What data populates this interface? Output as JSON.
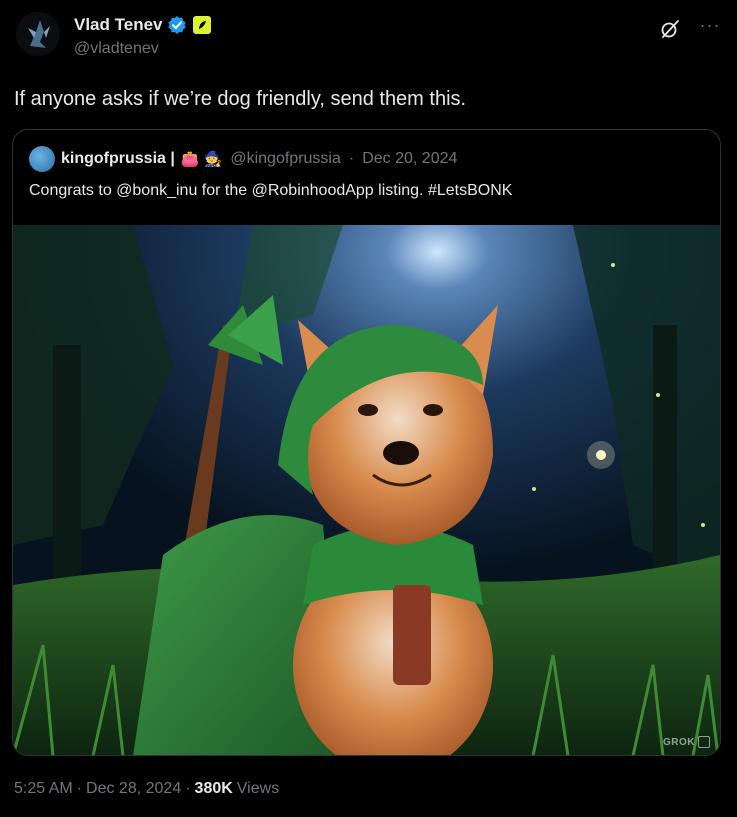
{
  "author": {
    "display_name": "Vlad Tenev",
    "handle": "@vladtenev",
    "verified_icon": "verified-badge-icon",
    "affiliation_icon": "robinhood-feather-icon",
    "accent_color": "#1d9bf0",
    "affiliation_color": "#dcf42e"
  },
  "toolbar": {
    "grok_icon": "grok-icon",
    "more_icon": "more-options-icon",
    "more_glyph": "···"
  },
  "tweet": {
    "text": "If anyone asks if we’re dog friendly, send them this."
  },
  "quote": {
    "display_name": "kingofprussia |",
    "emojis": "👛 🧙",
    "handle": "@kingofprussia",
    "separator": "·",
    "date": "Dec 20, 2024",
    "text": "Congrats to @bonk_inu for the @RobinhoodApp listing. #LetsBONK",
    "image_alt": "shiba-inu-robin-hood-image",
    "watermark": "GROK"
  },
  "footer": {
    "time": "5:25 AM",
    "sep1": "·",
    "date": "Dec 28, 2024",
    "sep2": "·",
    "views_count": "380K",
    "views_label": "Views"
  }
}
